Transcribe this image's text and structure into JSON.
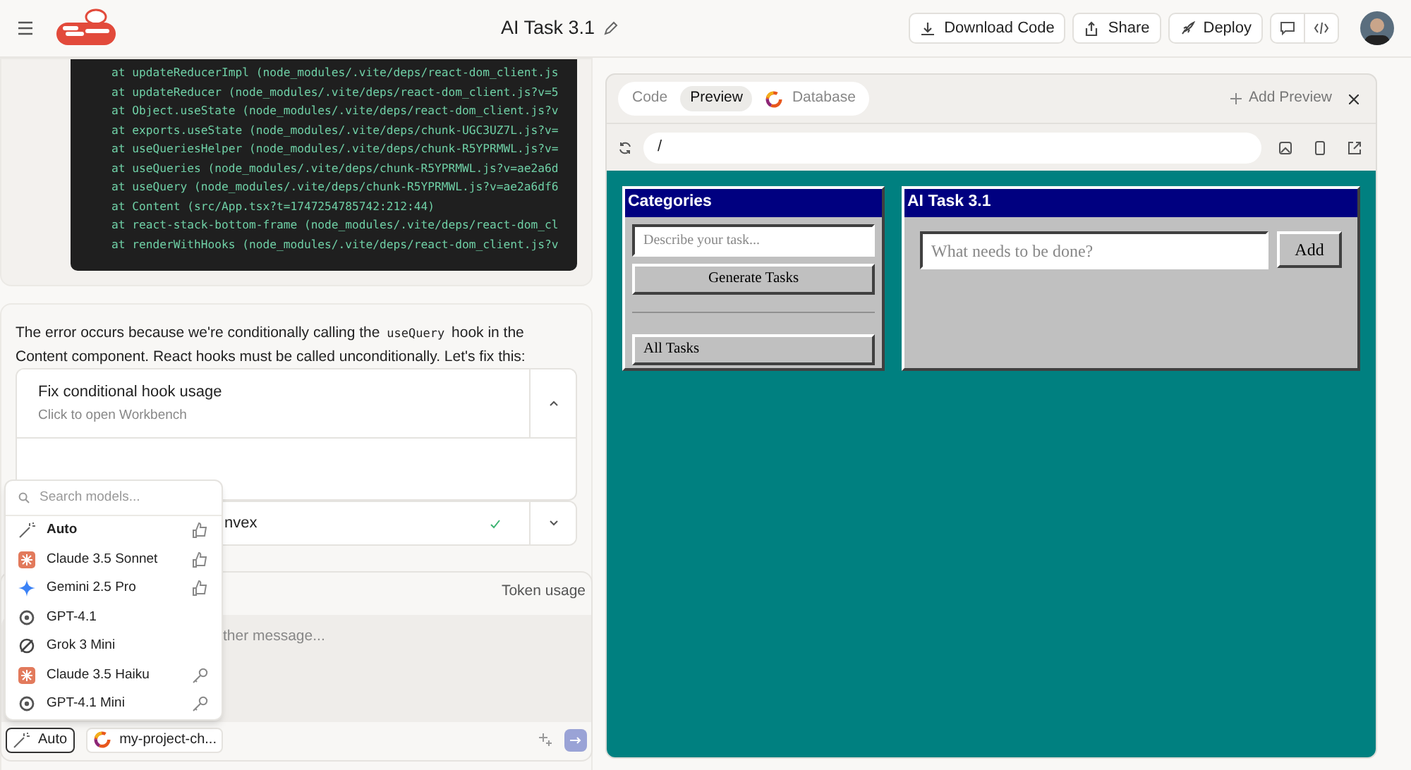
{
  "header": {
    "title": "AI Task 3.1",
    "buttons": [
      "Download Code",
      "Share",
      "Deploy"
    ]
  },
  "code_lines": [
    "at updateReducerImpl (node_modules/.vite/deps/react-dom_client.js",
    "at updateReducer (node_modules/.vite/deps/react-dom_client.js?v=5",
    "at Object.useState (node_modules/.vite/deps/react-dom_client.js?v",
    "at exports.useState (node_modules/.vite/deps/chunk-UGC3UZ7L.js?v=",
    "at useQueriesHelper (node_modules/.vite/deps/chunk-R5YPRMWL.js?v=",
    "at useQueries (node_modules/.vite/deps/chunk-R5YPRMWL.js?v=ae2a6d",
    "at useQuery (node_modules/.vite/deps/chunk-R5YPRMWL.js?v=ae2a6df6",
    "at Content (src/App.tsx?t=1747254785742:212:44)",
    "at react-stack-bottom-frame (node_modules/.vite/deps/react-dom_cl",
    "at renderWithHooks (node_modules/.vite/deps/react-dom_client.js?v"
  ],
  "message": {
    "before": "The error occurs because we're conditionally calling the",
    "code": "useQuery",
    "after": "hook in the Content component. React hooks must be called unconditionally. Let's fix this:"
  },
  "tool_cards": [
    {
      "title": "Fix conditional hook usage",
      "subtitle": "Click to open Workbench",
      "expanded": true,
      "done": false
    },
    {
      "title": "nvex",
      "expanded": false,
      "done": true
    }
  ],
  "token_usage": "Token usage",
  "chat_input": {
    "placeholder": "ther message..."
  },
  "model_menu": {
    "search_placeholder": "Search models...",
    "items": [
      {
        "label": "Auto",
        "kind": "auto",
        "recommended": true,
        "requires_key": false,
        "selected": true
      },
      {
        "label": "Claude 3.5 Sonnet",
        "kind": "claude",
        "recommended": true,
        "requires_key": false,
        "selected": false
      },
      {
        "label": "Gemini 2.5 Pro",
        "kind": "gemini",
        "recommended": true,
        "requires_key": false,
        "selected": false
      },
      {
        "label": "GPT-4.1",
        "kind": "gpt",
        "recommended": false,
        "requires_key": false,
        "selected": false
      },
      {
        "label": "Grok 3 Mini",
        "kind": "grok",
        "recommended": false,
        "requires_key": false,
        "selected": false
      },
      {
        "label": "Claude 3.5 Haiku",
        "kind": "claude",
        "recommended": false,
        "requires_key": true,
        "selected": false
      },
      {
        "label": "GPT-4.1 Mini",
        "kind": "gpt",
        "recommended": false,
        "requires_key": true,
        "selected": false
      }
    ]
  },
  "bottom_bar": {
    "model_button": "Auto",
    "project_button": "my-project-ch..."
  },
  "workbench": {
    "tabs": [
      {
        "label": "Code",
        "selected": false
      },
      {
        "label": "Preview",
        "selected": true
      },
      {
        "label": "Database",
        "selected": false
      }
    ],
    "add_preview": "Add Preview",
    "url": "/",
    "app": {
      "sidebar_title": "Categories",
      "describe_placeholder": "Describe your task...",
      "generate_button": "Generate Tasks",
      "categories": [
        "All Tasks"
      ],
      "main_title": "AI Task 3.1",
      "todo_placeholder": "What needs to be done?",
      "add_button": "Add"
    }
  }
}
